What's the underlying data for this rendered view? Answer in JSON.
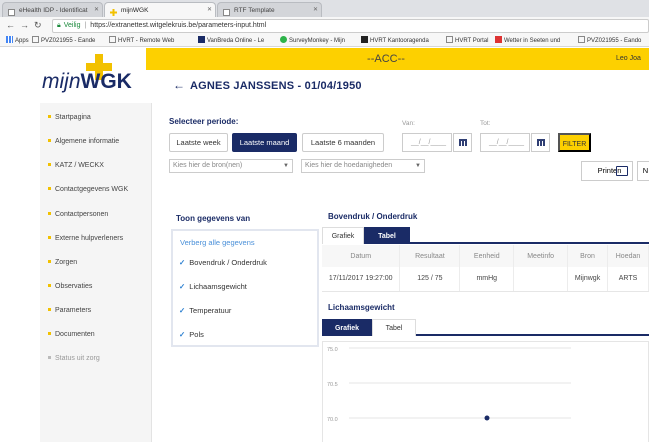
{
  "browser": {
    "tabs": [
      {
        "title": "eHealth IDP - Identificat",
        "active": false
      },
      {
        "title": "mijnWGK",
        "active": true
      },
      {
        "title": "RTF Template",
        "active": false
      }
    ],
    "secure_label": "Veilig",
    "url": "https://extranettest.witgelekruis.be/parameters-input.html",
    "bookmarks": [
      "Apps",
      "PVZ021955 - Eande",
      "HVRT - Remote Web",
      "VanBreda Online - Le",
      "SurveyMonkey - Mijn",
      "HVRT Kantooragenda",
      "HVRT Portal",
      "Wetter in Seeten und",
      "PVZ021955 - Eando"
    ]
  },
  "header": {
    "logo_light": "mijn",
    "logo_bold": "WGK",
    "env": "--ACC--",
    "user": "Leo Joa",
    "page_title": "AGNES JANSSENS - 01/04/1950",
    "brand_color": "#1a2b66",
    "accent_color": "#fdd000"
  },
  "sidebar": {
    "items": [
      {
        "label": "Startpagina",
        "muted": false
      },
      {
        "label": "Algemene informatie",
        "muted": false
      },
      {
        "label": "KATZ / WECKX",
        "muted": false
      },
      {
        "label": "Contactgegevens WGK",
        "muted": false
      },
      {
        "label": "Contactpersonen",
        "muted": false
      },
      {
        "label": "Externe hulpverleners",
        "muted": false
      },
      {
        "label": "Zorgen",
        "muted": false
      },
      {
        "label": "Observaties",
        "muted": false
      },
      {
        "label": "Parameters",
        "muted": false
      },
      {
        "label": "Documenten",
        "muted": false
      },
      {
        "label": "Status uit zorg",
        "muted": true
      }
    ]
  },
  "filters": {
    "periode_label": "Selecteer periode:",
    "buttons": [
      "Laatste week",
      "Laatste maand",
      "Laatste 6 maanden"
    ],
    "active_button": "Laatste maand",
    "van_label": "Van:",
    "tot_label": "Tot:",
    "date_placeholder": "__/__/____",
    "filter_button": "FILTER",
    "bron_placeholder": "Kies hier de bron(nen)",
    "hoedanigheden_placeholder": "Kies hier de hoedanigheden",
    "print_button": "Printen",
    "next_button": "N"
  },
  "toon": {
    "title": "Toon gegevens van",
    "hide_all": "Verberg alle gegevens",
    "items": [
      "Bovendruk / Onderdruk",
      "Lichaamsgewicht",
      "Temperatuur",
      "Pols"
    ]
  },
  "bloeddruk": {
    "title": "Bovendruk / Onderdruk",
    "tabs": [
      "Grafiek",
      "Tabel"
    ],
    "active_tab": "Tabel",
    "columns": [
      "Datum",
      "Resultaat",
      "Eenheid",
      "Meetinfo",
      "Bron",
      "Hoedan"
    ],
    "rows": [
      [
        "17/11/2017 19:27:00",
        "125 / 75",
        "mmHg",
        "",
        "Mijnwgk",
        "ARTS"
      ]
    ]
  },
  "gewicht": {
    "title": "Lichaamsgewicht",
    "tabs": [
      "Grafiek",
      "Tabel"
    ],
    "active_tab": "Grafiek"
  },
  "chart_data": {
    "type": "scatter",
    "title": "",
    "xlabel": "",
    "ylabel": "",
    "y_ticks": [
      "75.0",
      "70.5",
      "70.0"
    ],
    "points": [
      {
        "y": 70.0
      }
    ],
    "grid": true,
    "point_color": "#1a2b66"
  }
}
